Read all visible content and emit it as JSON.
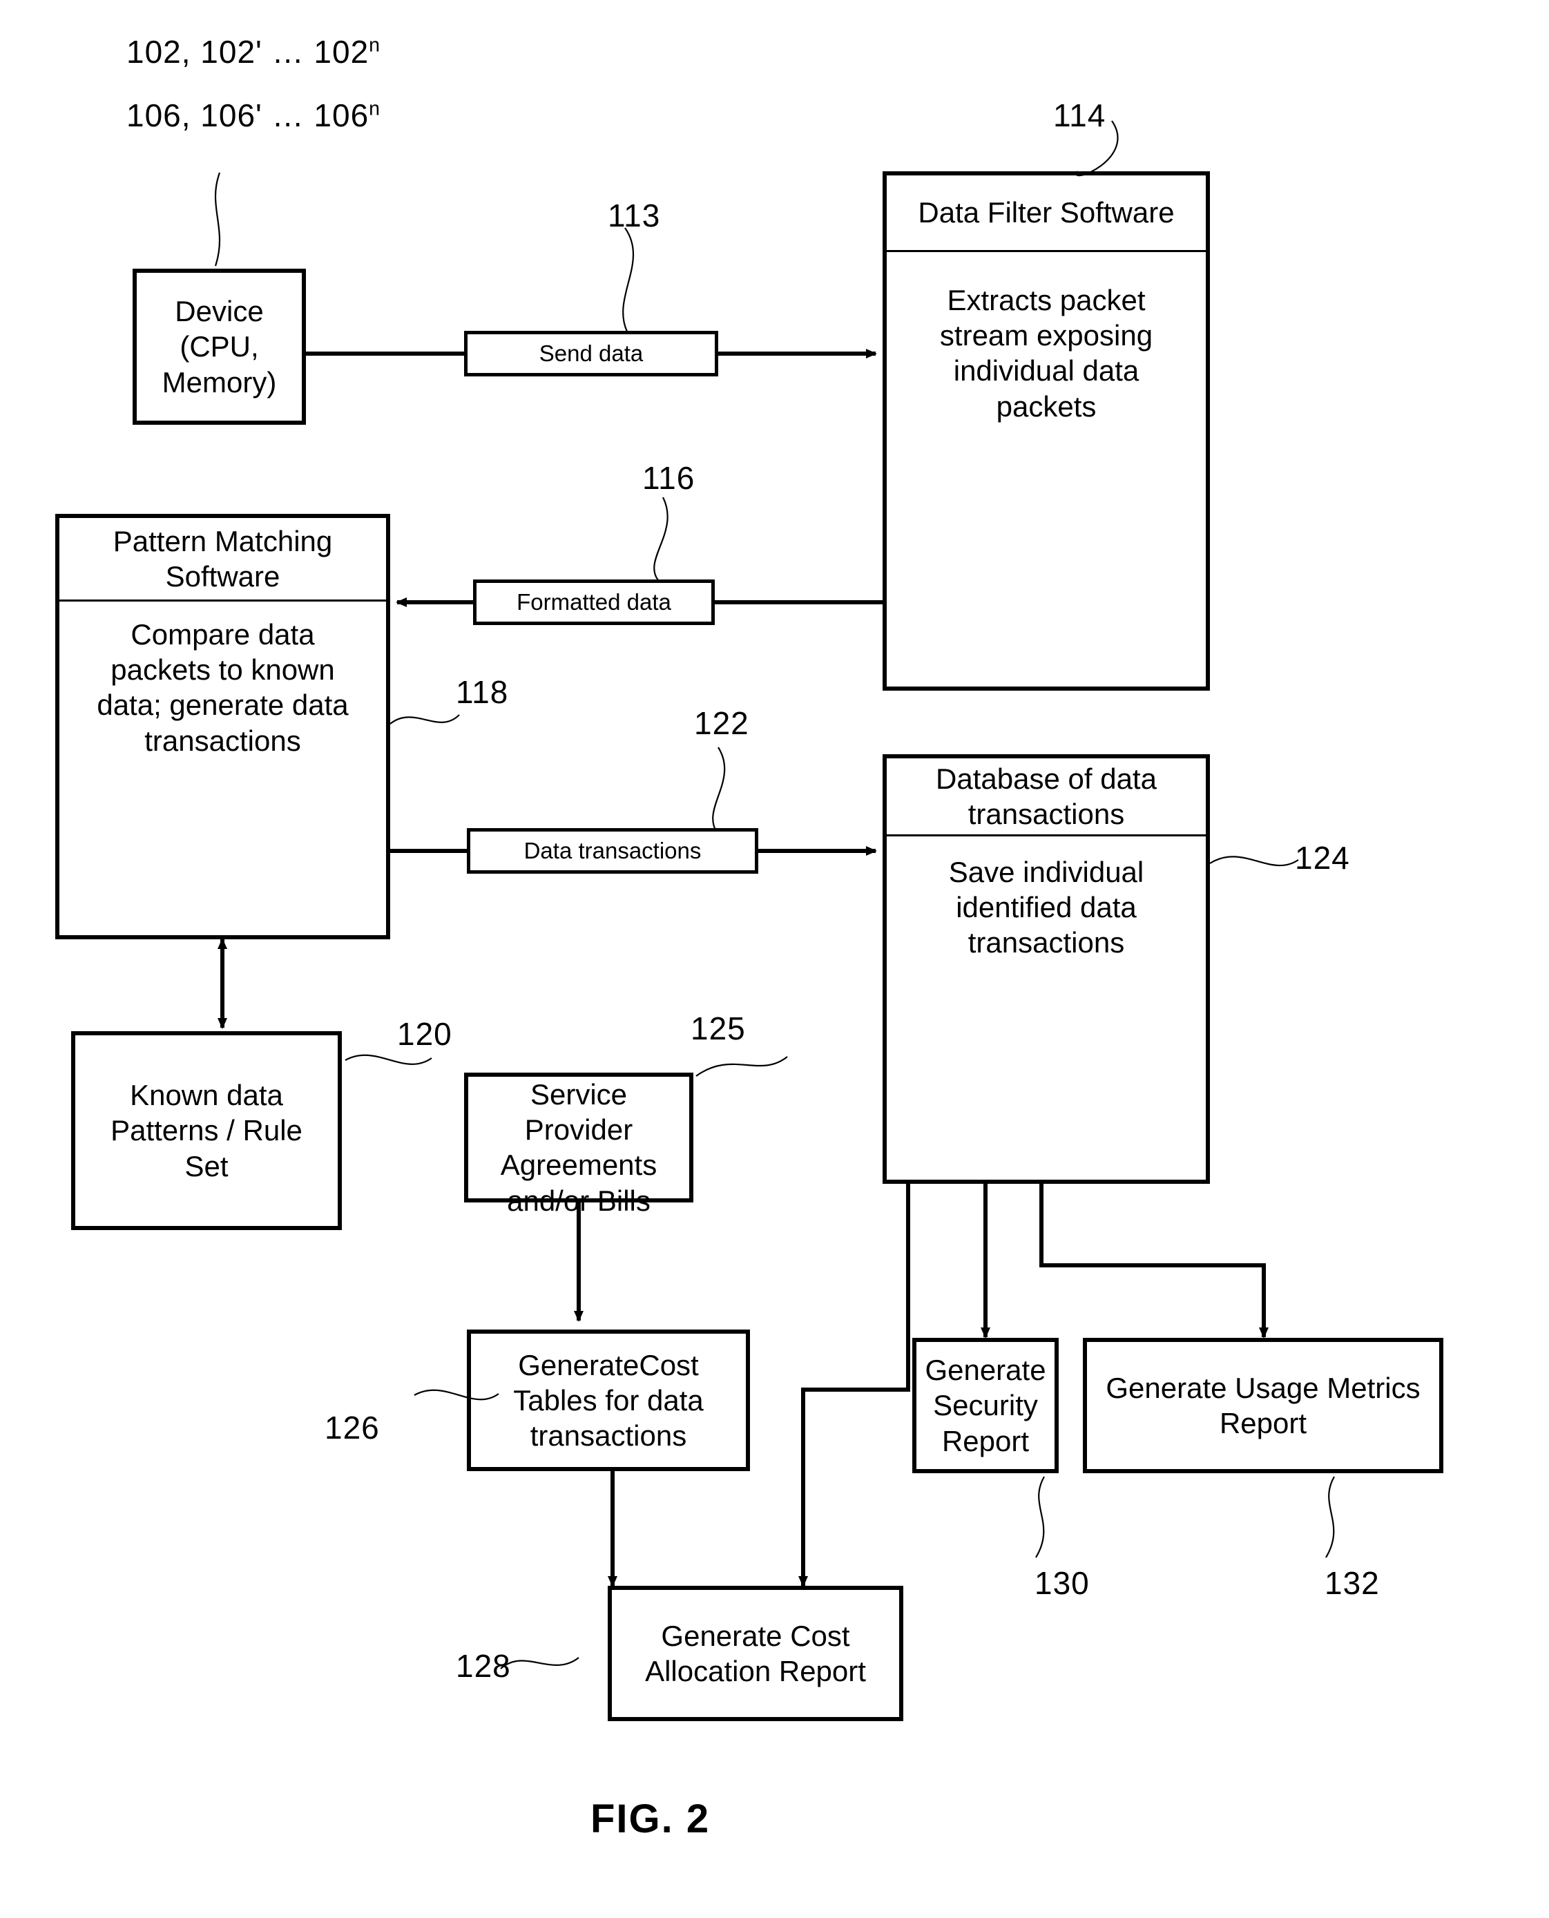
{
  "figure": {
    "caption": "FIG. 2"
  },
  "nodes": {
    "device": {
      "title": "Device\n(CPU,\nMemory)",
      "line1": "Device",
      "line2": "(CPU,",
      "line3": "Memory)"
    },
    "data_filter": {
      "title": "Data Filter Software",
      "body": "Extracts packet stream exposing individual data packets"
    },
    "pattern_matching": {
      "title": "Pattern Matching Software",
      "body": "Compare data packets to known data; generate data transactions"
    },
    "known_data": {
      "title": "Known data Patterns / Rule Set"
    },
    "database": {
      "title": "Database of data transactions",
      "body": "Save individual identified data transactions"
    },
    "service_provider": {
      "title": "Service Provider Agreements and/or Bills"
    },
    "generate_cost_tables": {
      "title": "GenerateCost Tables for data transactions"
    },
    "generate_cost_allocation_report": {
      "title": "Generate Cost Allocation Report"
    },
    "generate_security_report": {
      "title": "Generate Security Report"
    },
    "generate_usage_metrics_report": {
      "title": "Generate Usage Metrics Report"
    }
  },
  "connector_labels": {
    "send_data": "Send data",
    "formatted_data": "Formatted data",
    "data_transactions": "Data transactions"
  },
  "reference_numerals": {
    "devices_102": "102, 102' … 102",
    "devices_102_sup": "n",
    "devices_106": "106, 106' … 106",
    "devices_106_sup": "n",
    "n_113": "113",
    "n_114": "114",
    "n_116": "116",
    "n_118": "118",
    "n_120": "120",
    "n_122": "122",
    "n_124": "124",
    "n_125": "125",
    "n_126": "126",
    "n_128": "128",
    "n_130": "130",
    "n_132": "132"
  },
  "colors": {
    "ink": "#000000",
    "paper": "#ffffff"
  }
}
